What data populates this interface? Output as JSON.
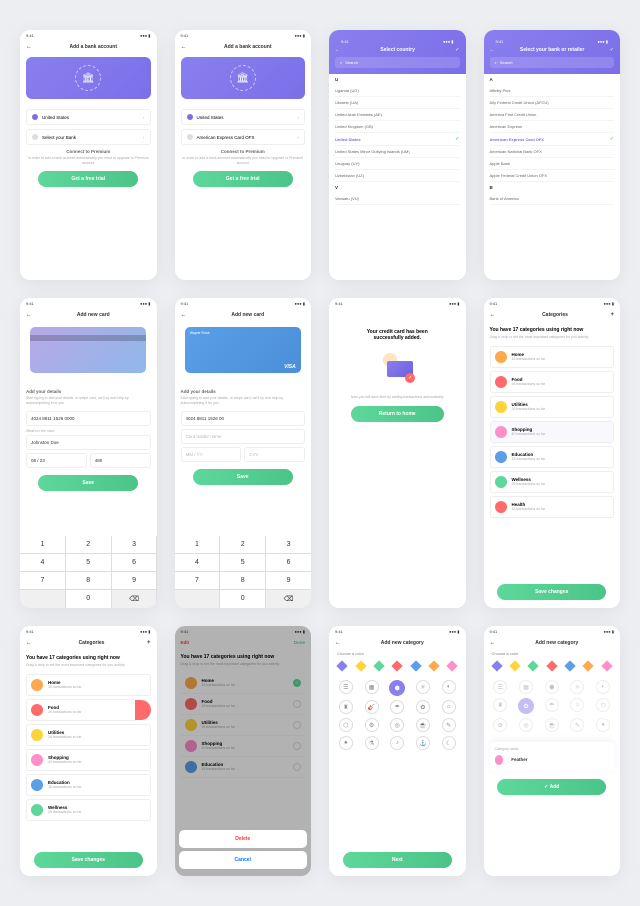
{
  "time": "9:41",
  "s1": {
    "title": "Add a bank account",
    "country": "United States",
    "bank": "Select your Bank",
    "premium": "Connect to Premium",
    "sub": "In order to add a bank account automatically you need to upgrade to Premium account",
    "btn": "Get a free trial"
  },
  "s2": {
    "title": "Add a bank account",
    "country": "United States",
    "bank": "American Express Card OFX",
    "premium": "Connect to Premium",
    "sub": "In order to add a bank account automatically you need to upgrade to Premium account",
    "btn": "Get a free trial"
  },
  "s3": {
    "title": "Select country",
    "search": "Search",
    "h1": "U",
    "items": [
      "Uganda (UG)",
      "Ukraine (UA)",
      "United Arab Emirates (AE)",
      "United Kingdom (GB)",
      "United States",
      "United States Minor Outlying Islands (UM)",
      "Uruguay (UY)",
      "Uzbekistan (UZ)"
    ],
    "h2": "V",
    "v": "Vanuatu (VU)"
  },
  "s4": {
    "title": "Select your bank or retailer",
    "search": "Search",
    "h1": "A",
    "items": [
      "Affinity Plus",
      "Ally Federal Credit Union (AFCU)",
      "America First Credit Union",
      "American Express",
      "American Express Card OFX",
      "American National Bank OFX",
      "Apple Bank",
      "Apple Federal Credit Union OFX"
    ],
    "h2": "B",
    "b": "Bank of America"
  },
  "s5": {
    "title": "Add new card",
    "dl": "Add your details",
    "ds": "Start typing to add your details, or swipe card, we'll try and help by autocompleting it for you",
    "num": "4024 8811 1526 0000",
    "exp": "08 / 23",
    "cvv": "480",
    "nl": "What's in the card",
    "name": "Johnston Doe",
    "btn": "Save"
  },
  "s6": {
    "title": "Add new card",
    "cardname": "Wayne Rose",
    "dl": "Add your details",
    "ds": "Start typing to add your details, or swipe card, we'll try and help by autocompleting it for you",
    "num": "4024 8811 1526 00",
    "nameph": "Card holder name",
    "expph": "MM / YY",
    "cvvph": "CVV",
    "btn": "Save"
  },
  "s7": {
    "t1": "Your credit card has been",
    "t2": "successfully added.",
    "sub": "Now you will save time by adding transactions automatically",
    "btn": "Return to home"
  },
  "s8": {
    "title": "Categories",
    "h": "You have 17 categories using right now",
    "s": "Drag & drop to set the most important categories for you activity",
    "cats": [
      {
        "n": "Home",
        "s": "18 transactions so far"
      },
      {
        "n": "Food",
        "s": "26 transactions so far"
      },
      {
        "n": "Utilities",
        "s": "26 transactions so far"
      },
      {
        "n": "Shopping",
        "s": "40 transactions so far"
      },
      {
        "n": "Education",
        "s": "18 transactions so far"
      },
      {
        "n": "Wellness",
        "s": "26 transactions so far"
      },
      {
        "n": "Health",
        "s": "18 transactions so far"
      }
    ],
    "btn": "Save changes"
  },
  "s9": {
    "title": "Categories",
    "h": "You have 17 categories using right now",
    "s": "Drag & drop to set the most important categories for you activity",
    "btn": "Save changes"
  },
  "s10": {
    "edit": "Edit",
    "done": "Done",
    "h": "You have 17 categories using right now",
    "s": "Drag & drop to set the most important categories for you activity",
    "del": "Delete",
    "can": "Cancel"
  },
  "s11": {
    "title": "Add new category",
    "cl": "Choose a color",
    "btn": "Next"
  },
  "s12": {
    "title": "Add new category",
    "cl": "Choose a color",
    "nl": "Category name",
    "name": "Feather",
    "btn": "Add"
  },
  "keys": [
    "1",
    "2",
    "3",
    "4",
    "5",
    "6",
    "7",
    "8",
    "9",
    "",
    "0",
    "⌫"
  ]
}
